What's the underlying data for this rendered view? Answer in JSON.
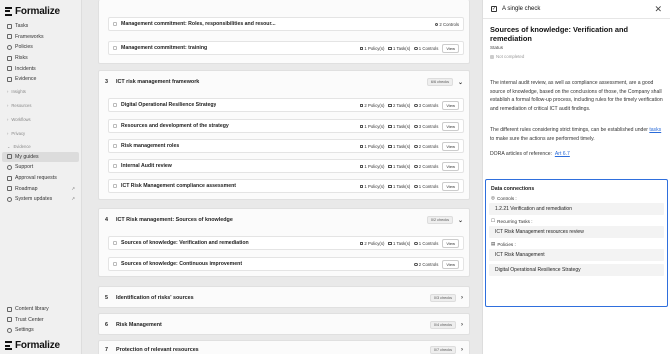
{
  "brand": {
    "name": "Formalize"
  },
  "sidebar": {
    "items": [
      {
        "label": "Tasks",
        "icon": "check-icon"
      },
      {
        "label": "Frameworks",
        "icon": "layers-icon"
      },
      {
        "label": "Policies",
        "icon": "shield-icon"
      },
      {
        "label": "Risks",
        "icon": "alert-icon"
      },
      {
        "label": "Incidents",
        "icon": "flag-icon"
      },
      {
        "label": "Evidence",
        "icon": "document-icon"
      }
    ],
    "sections": [
      {
        "label": "Insights"
      },
      {
        "label": "Resources"
      },
      {
        "label": "Workflows"
      },
      {
        "label": "Privacy"
      },
      {
        "label": "Evidence"
      }
    ],
    "items2": [
      {
        "label": "My guides",
        "icon": "guide-icon",
        "active": true
      },
      {
        "label": "Support",
        "icon": "help-icon"
      },
      {
        "label": "Approval requests",
        "icon": "approval-icon"
      },
      {
        "label": "Roadmap",
        "icon": "map-icon",
        "external": true
      },
      {
        "label": "System updates",
        "icon": "refresh-icon",
        "external": true
      }
    ],
    "bottom": [
      {
        "label": "Content library",
        "icon": "library-icon"
      },
      {
        "label": "Trust Center",
        "icon": "trust-icon"
      },
      {
        "label": "Settings",
        "icon": "gear-icon"
      }
    ]
  },
  "main": {
    "top_rows": [
      {
        "title": "Management commitment: Roles, responsibilities and resour...",
        "controls": "2 Controls"
      },
      {
        "title": "Management commitment: training",
        "policies": "1 Policy(s)",
        "tasks": "1 Task(s)",
        "controls": "1 Controls",
        "view": "View"
      }
    ],
    "sections": [
      {
        "num": "3",
        "title": "ICT risk management framework",
        "badge": "6/6 checks",
        "rows": [
          {
            "title": "Digital Operational Resilience Strategy",
            "policies": "2 Policy(s)",
            "tasks": "2 Task(s)",
            "controls": "3 Controls",
            "view": "View"
          },
          {
            "title": "Resources and development of the strategy",
            "policies": "1 Policy(s)",
            "tasks": "1 Task(s)",
            "controls": "3 Controls",
            "view": "View"
          },
          {
            "title": "Risk management roles",
            "policies": "1 Policy(s)",
            "tasks": "1 Task(s)",
            "controls": "2 Controls",
            "view": "View"
          },
          {
            "title": "Internal Audit review",
            "policies": "1 Policy(s)",
            "tasks": "1 Task(s)",
            "controls": "2 Controls",
            "view": "View"
          },
          {
            "title": "ICT Risk Management compliance assessment",
            "policies": "1 Policy(s)",
            "tasks": "1 Task(s)",
            "controls": "1 Controls",
            "view": "View"
          }
        ]
      },
      {
        "num": "4",
        "title": "ICT Risk management: Sources of knowledge",
        "badge": "0/2 checks",
        "rows": [
          {
            "title": "Sources of knowledge: Verification and remediation",
            "policies": "2 Policy(s)",
            "tasks": "1 Task(s)",
            "controls": "1 Controls",
            "view": "View"
          },
          {
            "title": "Sources of knowledge: Continuous improvement",
            "controls": "2 Controls",
            "view": "View"
          }
        ]
      },
      {
        "num": "5",
        "title": "Identification of risks' sources",
        "badge": "0/3 checks"
      },
      {
        "num": "6",
        "title": "Risk Management",
        "badge": "0/4 checks"
      },
      {
        "num": "7",
        "title": "Protection of relevant resources",
        "badge": "0/7 checks"
      }
    ]
  },
  "panel": {
    "header": "A single check",
    "title": "Sources of knowledge: Verification and remediation",
    "status_label": "Status",
    "status_value": "Not completed",
    "para1": "The internal audit review, as well as compliance assessment, are a good source of knowledge, based on the conclusions of those, the Company shall establish a formal follow-up process, including rules for the timely verification and remediation of critical ICT audit findings.",
    "para2_before": "The different rules considering strict timings, can be established under ",
    "para2_link": "tasks",
    "para2_after": " to make sure the actions are performed timely.",
    "dora_label": "DORA articles of reference:",
    "dora_link": "Art 6.7",
    "data_connections": {
      "title": "Data connections",
      "controls_label": "Controls :",
      "controls": [
        "1.2.21 Verification and remediation"
      ],
      "tasks_label": "Recurring Tasks :",
      "tasks": [
        "ICT Risk Management resources review"
      ],
      "policies_label": "Policies :",
      "policies": [
        "ICT Risk Management",
        "Digital Operational Resilience Strategy"
      ]
    }
  }
}
